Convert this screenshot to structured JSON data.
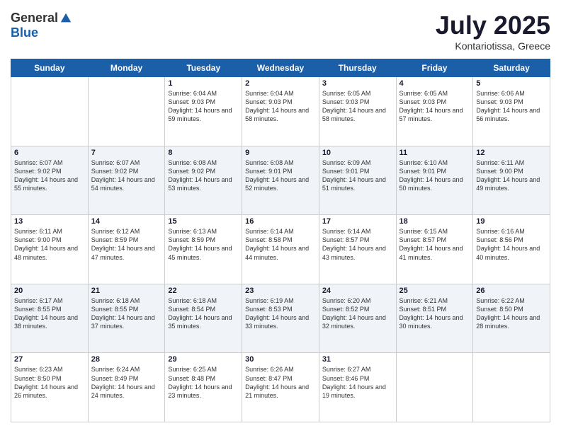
{
  "header": {
    "logo_general": "General",
    "logo_blue": "Blue",
    "month": "July 2025",
    "location": "Kontariotissa, Greece"
  },
  "days_of_week": [
    "Sunday",
    "Monday",
    "Tuesday",
    "Wednesday",
    "Thursday",
    "Friday",
    "Saturday"
  ],
  "weeks": [
    [
      {
        "day": "",
        "sunrise": "",
        "sunset": "",
        "daylight": ""
      },
      {
        "day": "",
        "sunrise": "",
        "sunset": "",
        "daylight": ""
      },
      {
        "day": "1",
        "sunrise": "Sunrise: 6:04 AM",
        "sunset": "Sunset: 9:03 PM",
        "daylight": "Daylight: 14 hours and 59 minutes."
      },
      {
        "day": "2",
        "sunrise": "Sunrise: 6:04 AM",
        "sunset": "Sunset: 9:03 PM",
        "daylight": "Daylight: 14 hours and 58 minutes."
      },
      {
        "day": "3",
        "sunrise": "Sunrise: 6:05 AM",
        "sunset": "Sunset: 9:03 PM",
        "daylight": "Daylight: 14 hours and 58 minutes."
      },
      {
        "day": "4",
        "sunrise": "Sunrise: 6:05 AM",
        "sunset": "Sunset: 9:03 PM",
        "daylight": "Daylight: 14 hours and 57 minutes."
      },
      {
        "day": "5",
        "sunrise": "Sunrise: 6:06 AM",
        "sunset": "Sunset: 9:03 PM",
        "daylight": "Daylight: 14 hours and 56 minutes."
      }
    ],
    [
      {
        "day": "6",
        "sunrise": "Sunrise: 6:07 AM",
        "sunset": "Sunset: 9:02 PM",
        "daylight": "Daylight: 14 hours and 55 minutes."
      },
      {
        "day": "7",
        "sunrise": "Sunrise: 6:07 AM",
        "sunset": "Sunset: 9:02 PM",
        "daylight": "Daylight: 14 hours and 54 minutes."
      },
      {
        "day": "8",
        "sunrise": "Sunrise: 6:08 AM",
        "sunset": "Sunset: 9:02 PM",
        "daylight": "Daylight: 14 hours and 53 minutes."
      },
      {
        "day": "9",
        "sunrise": "Sunrise: 6:08 AM",
        "sunset": "Sunset: 9:01 PM",
        "daylight": "Daylight: 14 hours and 52 minutes."
      },
      {
        "day": "10",
        "sunrise": "Sunrise: 6:09 AM",
        "sunset": "Sunset: 9:01 PM",
        "daylight": "Daylight: 14 hours and 51 minutes."
      },
      {
        "day": "11",
        "sunrise": "Sunrise: 6:10 AM",
        "sunset": "Sunset: 9:01 PM",
        "daylight": "Daylight: 14 hours and 50 minutes."
      },
      {
        "day": "12",
        "sunrise": "Sunrise: 6:11 AM",
        "sunset": "Sunset: 9:00 PM",
        "daylight": "Daylight: 14 hours and 49 minutes."
      }
    ],
    [
      {
        "day": "13",
        "sunrise": "Sunrise: 6:11 AM",
        "sunset": "Sunset: 9:00 PM",
        "daylight": "Daylight: 14 hours and 48 minutes."
      },
      {
        "day": "14",
        "sunrise": "Sunrise: 6:12 AM",
        "sunset": "Sunset: 8:59 PM",
        "daylight": "Daylight: 14 hours and 47 minutes."
      },
      {
        "day": "15",
        "sunrise": "Sunrise: 6:13 AM",
        "sunset": "Sunset: 8:59 PM",
        "daylight": "Daylight: 14 hours and 45 minutes."
      },
      {
        "day": "16",
        "sunrise": "Sunrise: 6:14 AM",
        "sunset": "Sunset: 8:58 PM",
        "daylight": "Daylight: 14 hours and 44 minutes."
      },
      {
        "day": "17",
        "sunrise": "Sunrise: 6:14 AM",
        "sunset": "Sunset: 8:57 PM",
        "daylight": "Daylight: 14 hours and 43 minutes."
      },
      {
        "day": "18",
        "sunrise": "Sunrise: 6:15 AM",
        "sunset": "Sunset: 8:57 PM",
        "daylight": "Daylight: 14 hours and 41 minutes."
      },
      {
        "day": "19",
        "sunrise": "Sunrise: 6:16 AM",
        "sunset": "Sunset: 8:56 PM",
        "daylight": "Daylight: 14 hours and 40 minutes."
      }
    ],
    [
      {
        "day": "20",
        "sunrise": "Sunrise: 6:17 AM",
        "sunset": "Sunset: 8:55 PM",
        "daylight": "Daylight: 14 hours and 38 minutes."
      },
      {
        "day": "21",
        "sunrise": "Sunrise: 6:18 AM",
        "sunset": "Sunset: 8:55 PM",
        "daylight": "Daylight: 14 hours and 37 minutes."
      },
      {
        "day": "22",
        "sunrise": "Sunrise: 6:18 AM",
        "sunset": "Sunset: 8:54 PM",
        "daylight": "Daylight: 14 hours and 35 minutes."
      },
      {
        "day": "23",
        "sunrise": "Sunrise: 6:19 AM",
        "sunset": "Sunset: 8:53 PM",
        "daylight": "Daylight: 14 hours and 33 minutes."
      },
      {
        "day": "24",
        "sunrise": "Sunrise: 6:20 AM",
        "sunset": "Sunset: 8:52 PM",
        "daylight": "Daylight: 14 hours and 32 minutes."
      },
      {
        "day": "25",
        "sunrise": "Sunrise: 6:21 AM",
        "sunset": "Sunset: 8:51 PM",
        "daylight": "Daylight: 14 hours and 30 minutes."
      },
      {
        "day": "26",
        "sunrise": "Sunrise: 6:22 AM",
        "sunset": "Sunset: 8:50 PM",
        "daylight": "Daylight: 14 hours and 28 minutes."
      }
    ],
    [
      {
        "day": "27",
        "sunrise": "Sunrise: 6:23 AM",
        "sunset": "Sunset: 8:50 PM",
        "daylight": "Daylight: 14 hours and 26 minutes."
      },
      {
        "day": "28",
        "sunrise": "Sunrise: 6:24 AM",
        "sunset": "Sunset: 8:49 PM",
        "daylight": "Daylight: 14 hours and 24 minutes."
      },
      {
        "day": "29",
        "sunrise": "Sunrise: 6:25 AM",
        "sunset": "Sunset: 8:48 PM",
        "daylight": "Daylight: 14 hours and 23 minutes."
      },
      {
        "day": "30",
        "sunrise": "Sunrise: 6:26 AM",
        "sunset": "Sunset: 8:47 PM",
        "daylight": "Daylight: 14 hours and 21 minutes."
      },
      {
        "day": "31",
        "sunrise": "Sunrise: 6:27 AM",
        "sunset": "Sunset: 8:46 PM",
        "daylight": "Daylight: 14 hours and 19 minutes."
      },
      {
        "day": "",
        "sunrise": "",
        "sunset": "",
        "daylight": ""
      },
      {
        "day": "",
        "sunrise": "",
        "sunset": "",
        "daylight": ""
      }
    ]
  ]
}
